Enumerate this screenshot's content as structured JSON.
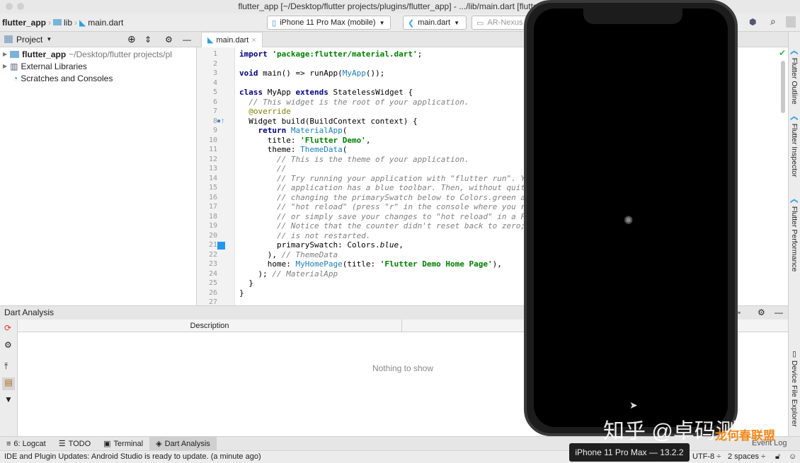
{
  "window": {
    "title": "flutter_app [~/Desktop/flutter projects/plugins/flutter_app] - .../lib/main.dart [flutter_app]"
  },
  "breadcrumb": [
    "flutter_app",
    "lib",
    "main.dart"
  ],
  "toolbar": {
    "device": "iPhone 11 Pro Max (mobile)",
    "run_config": "main.dart",
    "avd": "AR-Nexus"
  },
  "project": {
    "title": "Project",
    "items": [
      {
        "label": "flutter_app",
        "path": "~/Desktop/flutter projects/pl"
      },
      {
        "label": "External Libraries"
      },
      {
        "label": "Scratches and Consoles"
      }
    ]
  },
  "editor": {
    "tab": "main.dart",
    "current_line": 23,
    "lines": [
      [
        [
          "import ",
          "k"
        ],
        [
          "'package:flutter/material.dart'",
          "s"
        ],
        [
          ";",
          ""
        ]
      ],
      [],
      [
        [
          "void ",
          "k"
        ],
        [
          "main() => runApp(",
          ""
        ],
        [
          "MyApp",
          "t"
        ],
        [
          "());",
          ""
        ]
      ],
      [],
      [
        [
          "class ",
          "k"
        ],
        [
          "MyApp ",
          ""
        ],
        [
          "extends ",
          "k"
        ],
        [
          "StatelessWidget {",
          ""
        ]
      ],
      [
        [
          "  // This widget is the root of your application.",
          "c"
        ]
      ],
      [
        [
          "  @override",
          "a"
        ]
      ],
      [
        [
          "  Widget build(BuildContext context) {",
          ""
        ]
      ],
      [
        [
          "    return ",
          "k"
        ],
        [
          "MaterialApp",
          "t"
        ],
        [
          "(",
          ""
        ]
      ],
      [
        [
          "      title: ",
          ""
        ],
        [
          "'Flutter Demo'",
          "s"
        ],
        [
          ",",
          ""
        ]
      ],
      [
        [
          "      theme: ",
          ""
        ],
        [
          "ThemeData",
          "t"
        ],
        [
          "(",
          ""
        ]
      ],
      [
        [
          "        // This is the theme of your application.",
          "c"
        ]
      ],
      [
        [
          "        //",
          "c"
        ]
      ],
      [
        [
          "        // Try running your application with \"flutter run\". You'",
          "c"
        ]
      ],
      [
        [
          "        // application has a blue toolbar. Then, without quittin",
          "c"
        ]
      ],
      [
        [
          "        // changing the primarySwatch below to Colors.green and",
          "c"
        ]
      ],
      [
        [
          "        // \"hot reload\" (press \"r\" in the console where you ran",
          "c"
        ]
      ],
      [
        [
          "        // or simply save your changes to \"hot reload\" in a Flut",
          "c"
        ]
      ],
      [
        [
          "        // Notice that the counter didn't reset back to zero; th",
          "c"
        ]
      ],
      [
        [
          "        // is not restarted.",
          "c"
        ]
      ],
      [
        [
          "        primarySwatch: Colors.",
          ""
        ],
        [
          "blue",
          "i"
        ],
        [
          ",",
          ""
        ]
      ],
      [
        [
          "      ), ",
          ""
        ],
        [
          "// ThemeData",
          "c"
        ]
      ],
      [
        [
          "      home: ",
          ""
        ],
        [
          "MyHomePage",
          "t"
        ],
        [
          "(title: ",
          ""
        ],
        [
          "'Flutter Demo Home Page'",
          "s"
        ],
        [
          "),",
          ""
        ]
      ],
      [
        [
          "    ); ",
          ""
        ],
        [
          "// MaterialApp",
          "c"
        ]
      ],
      [
        [
          "  }",
          ""
        ]
      ],
      [
        [
          "}",
          ""
        ]
      ],
      []
    ]
  },
  "analysis": {
    "title": "Dart Analysis",
    "column": "Description",
    "empty": "Nothing to show"
  },
  "bottom_tabs": [
    "6: Logcat",
    "TODO",
    "Terminal",
    "Dart Analysis"
  ],
  "status": {
    "message": "IDE and Plugin Updates: Android Studio is ready to update. (a minute ago)",
    "encoding": "UTF-8",
    "indent": "2 spaces",
    "event_log": "Event Log"
  },
  "right_panels": [
    "Flutter Outline",
    "Flutter Inspector",
    "Flutter Performance",
    "Device File Explorer"
  ],
  "simulator": {
    "tooltip": "iPhone 11 Pro Max — 13.2.2"
  },
  "watermark": {
    "text": "知乎 @卓码测评",
    "logo": "龙何春联盟"
  }
}
